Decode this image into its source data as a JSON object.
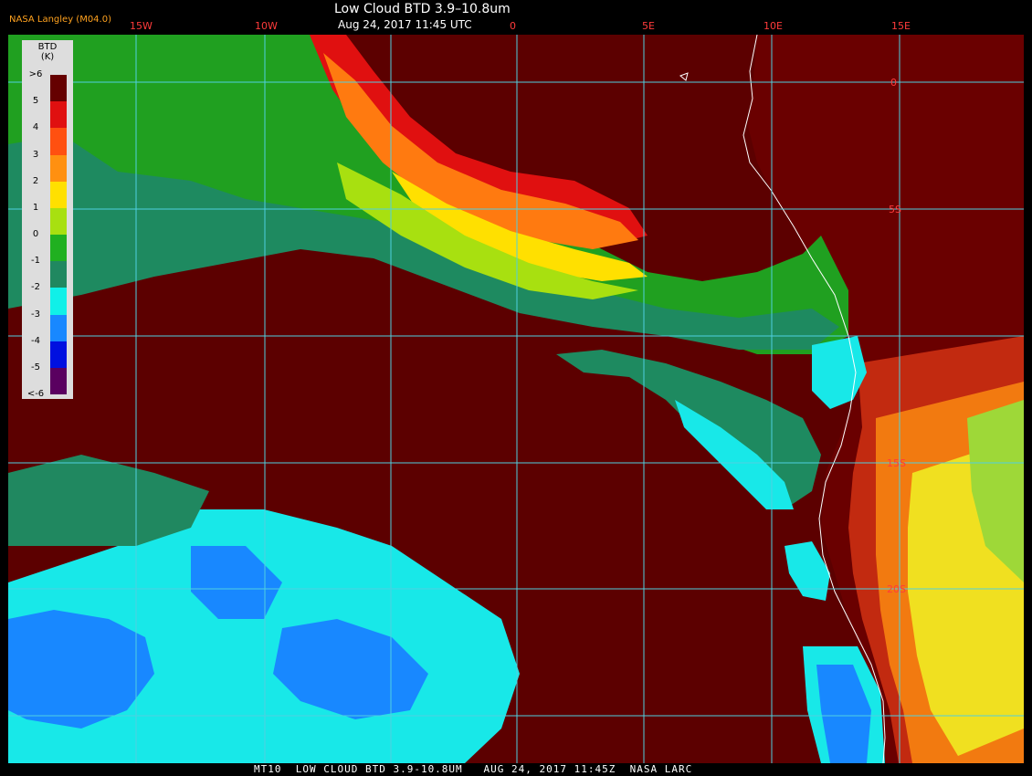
{
  "header": {
    "producer": "NASA Langley (M04.0)",
    "title": "Low Cloud BTD 3.9–10.8um",
    "subtitle": "Aug 24, 2017 11:45 UTC"
  },
  "legend": {
    "title": "BTD",
    "unit": "(K)",
    "ticks": [
      ">6",
      "5",
      "4",
      "3",
      "2",
      "1",
      "0",
      "-1",
      "-2",
      "-3",
      "-4",
      "-5",
      "<-6"
    ],
    "colors": [
      "#650000",
      "#e01010",
      "#ff5010",
      "#ff9010",
      "#ffe000",
      "#a8e010",
      "#20b020",
      "#208860",
      "#10f0e8",
      "#1888ff",
      "#0010e0",
      "#5a0060"
    ]
  },
  "grid": {
    "lon_labels": [
      "15W",
      "10W",
      "0",
      "5E",
      "10E",
      "15E"
    ],
    "lat_labels": [
      "0",
      "5S",
      "15S",
      "20S"
    ]
  },
  "footer": {
    "text": "MT10  LOW CLOUD BTD 3.9-10.8UM   AUG 24, 2017 11:45Z  NASA LARC"
  }
}
